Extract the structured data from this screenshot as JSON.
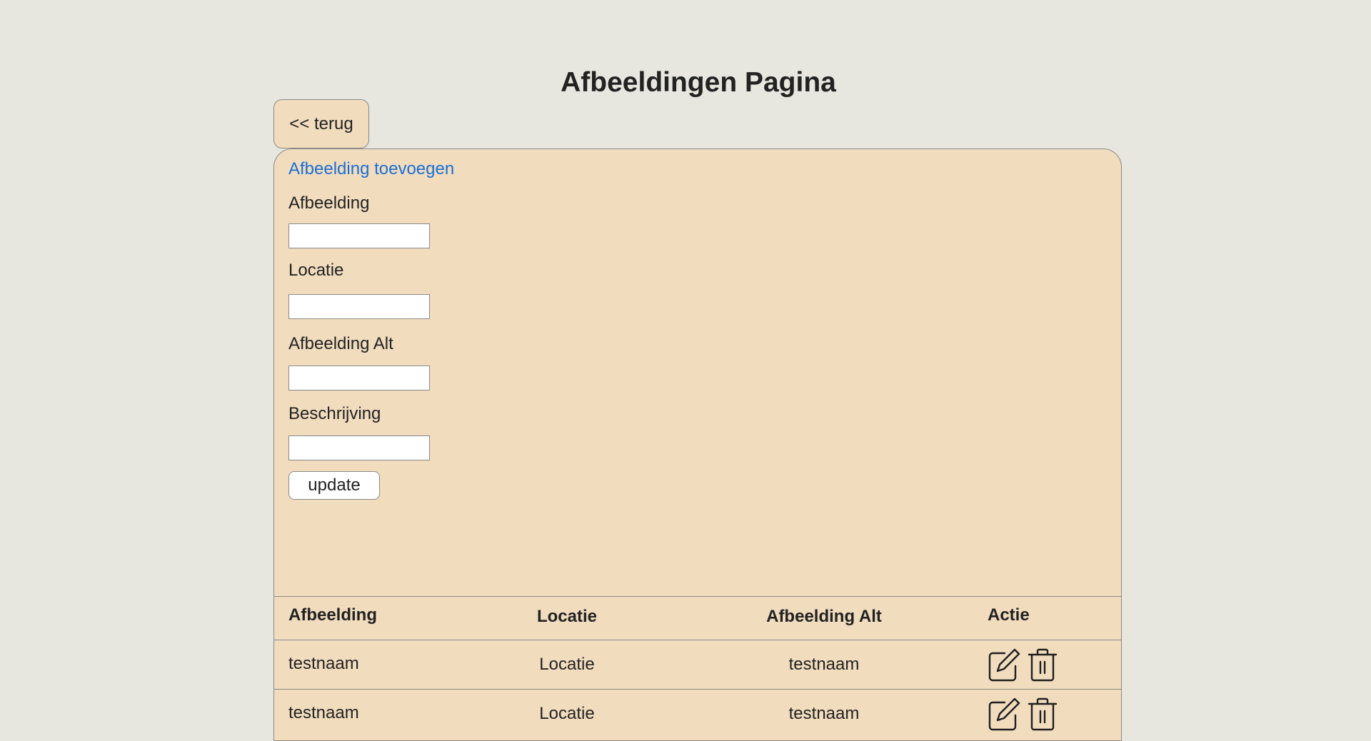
{
  "page": {
    "title": "Afbeeldingen Pagina"
  },
  "nav": {
    "back_label": "<< terug"
  },
  "form": {
    "add_link_label": "Afbeelding toevoegen",
    "fields": [
      {
        "label": "Afbeelding",
        "value": "",
        "placeholder": ""
      },
      {
        "label": "Locatie",
        "value": "",
        "placeholder": ""
      },
      {
        "label": "Afbeelding Alt",
        "value": "",
        "placeholder": ""
      },
      {
        "label": "Beschrijving",
        "value": "",
        "placeholder": ""
      }
    ],
    "submit_label": "update"
  },
  "table": {
    "headers": [
      "Afbeelding",
      "Locatie",
      "Afbeelding Alt",
      "Actie"
    ],
    "rows": [
      {
        "afbeelding": "testnaam",
        "locatie": "Locatie",
        "alt": "testnaam",
        "actions": [
          "edit-icon",
          "trash-icon"
        ]
      },
      {
        "afbeelding": "testnaam",
        "locatie": "Locatie",
        "alt": "testnaam",
        "actions": [
          "edit-icon",
          "trash-icon"
        ]
      }
    ]
  },
  "colors": {
    "background": "#e7e6df",
    "panel": "#f1dcbe",
    "link": "#1a6fd6",
    "border": "#8a8a8a"
  }
}
